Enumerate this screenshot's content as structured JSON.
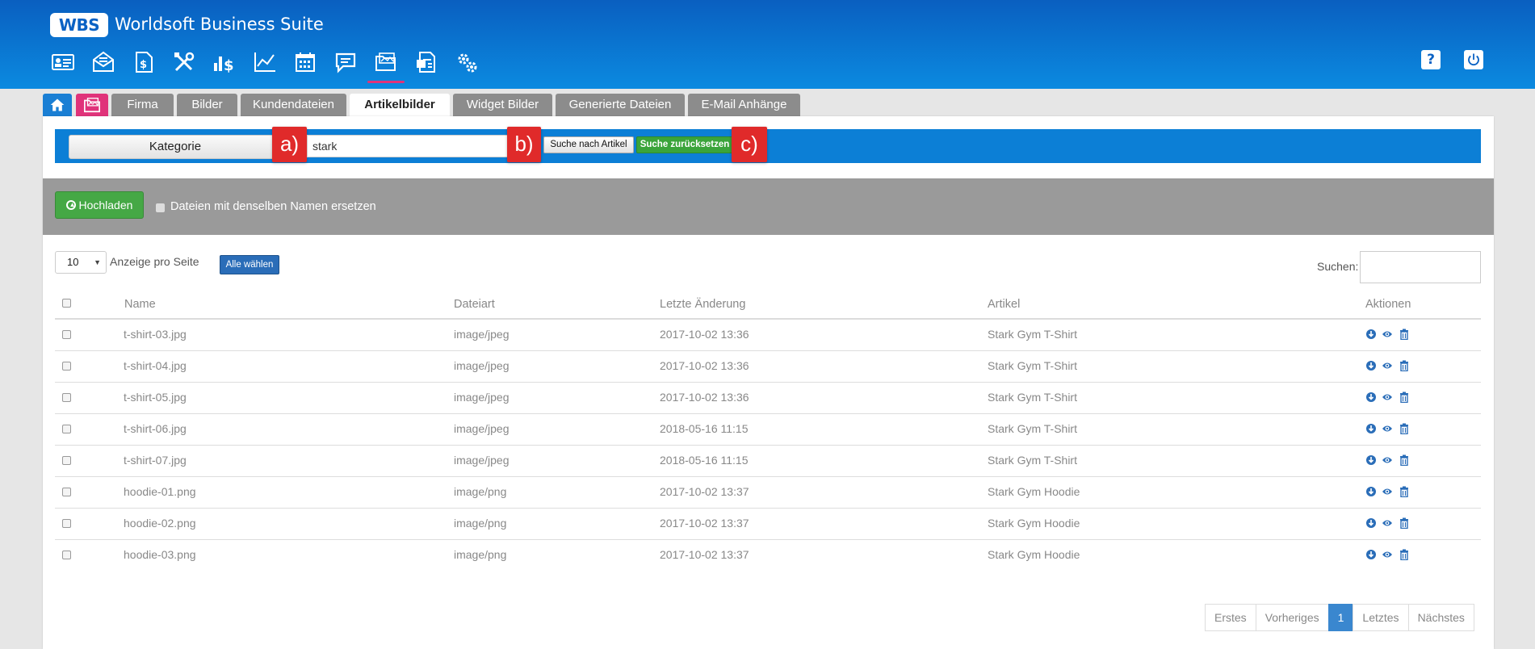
{
  "app": {
    "logo": "WBS",
    "title": "Worldsoft Business Suite"
  },
  "toolbar": {
    "icons": [
      "contact-card-icon",
      "mail-icon",
      "document-money-icon",
      "tools-icon",
      "sales-chart-icon",
      "line-chart-icon",
      "calendar-icon",
      "comment-icon",
      "folder-images-icon",
      "invoice-icon",
      "settings-gears-icon"
    ],
    "active_index": 8,
    "right": [
      "help-icon",
      "power-icon"
    ]
  },
  "tabs": [
    "Firma",
    "Bilder",
    "Kundendateien",
    "Artikelbilder",
    "Widget Bilder",
    "Generierte Dateien",
    "E-Mail Anhänge"
  ],
  "active_tab": "Artikelbilder",
  "search": {
    "category_label": "Kategorie",
    "query": "stark",
    "search_button": "Suche nach Artikel",
    "reset_button": "Suche zurücksetzen",
    "markers": [
      "a)",
      "b)",
      "c)"
    ]
  },
  "upload": {
    "button": "Hochladen",
    "replace_label": "Dateien mit denselben Namen ersetzen"
  },
  "list_controls": {
    "per_page_value": "10",
    "per_page_label": "Anzeige pro Seite",
    "select_all": "Alle wählen",
    "search_label": "Suchen:"
  },
  "table": {
    "headers": [
      "Name",
      "Dateiart",
      "Letzte Änderung",
      "Artikel",
      "Aktionen"
    ],
    "rows": [
      {
        "name": "t-shirt-03.jpg",
        "type": "image/jpeg",
        "modified": "2017-10-02 13:36",
        "article": "Stark Gym T-Shirt"
      },
      {
        "name": "t-shirt-04.jpg",
        "type": "image/jpeg",
        "modified": "2017-10-02 13:36",
        "article": "Stark Gym T-Shirt"
      },
      {
        "name": "t-shirt-05.jpg",
        "type": "image/jpeg",
        "modified": "2017-10-02 13:36",
        "article": "Stark Gym T-Shirt"
      },
      {
        "name": "t-shirt-06.jpg",
        "type": "image/jpeg",
        "modified": "2018-05-16 11:15",
        "article": "Stark Gym T-Shirt"
      },
      {
        "name": "t-shirt-07.jpg",
        "type": "image/jpeg",
        "modified": "2018-05-16 11:15",
        "article": "Stark Gym T-Shirt"
      },
      {
        "name": "hoodie-01.png",
        "type": "image/png",
        "modified": "2017-10-02 13:37",
        "article": "Stark Gym Hoodie"
      },
      {
        "name": "hoodie-02.png",
        "type": "image/png",
        "modified": "2017-10-02 13:37",
        "article": "Stark Gym Hoodie"
      },
      {
        "name": "hoodie-03.png",
        "type": "image/png",
        "modified": "2017-10-02 13:37",
        "article": "Stark Gym Hoodie"
      }
    ]
  },
  "pagination": {
    "first": "Erstes",
    "prev": "Vorheriges",
    "current": "1",
    "last": "Letztes",
    "next": "Nächstes"
  },
  "colors": {
    "header": "#0b7fd8",
    "accent": "#e0337a",
    "marker": "#e02a2a",
    "success": "#3aa43a",
    "link": "#2a6db8"
  }
}
